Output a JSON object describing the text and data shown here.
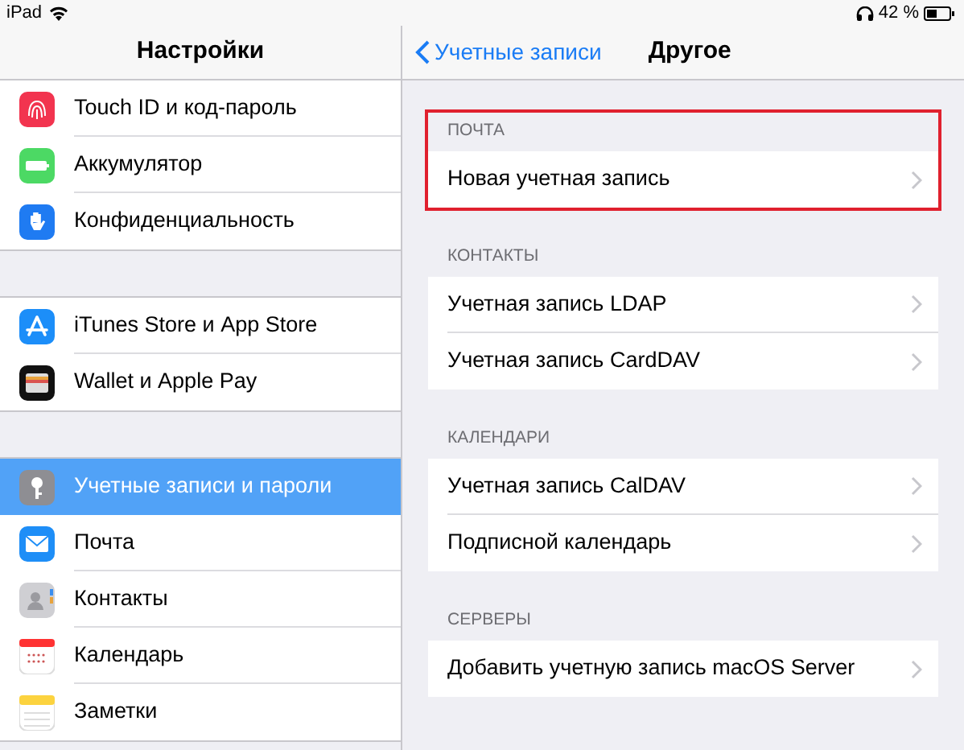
{
  "status_bar": {
    "device": "iPad",
    "battery_text": "42 %"
  },
  "sidebar": {
    "title": "Настройки",
    "groups": [
      {
        "items": [
          {
            "label": "Touch ID и код-пароль",
            "selected": false
          },
          {
            "label": "Аккумулятор",
            "selected": false
          },
          {
            "label": "Конфиденциальность",
            "selected": false
          }
        ]
      },
      {
        "items": [
          {
            "label": "iTunes Store и App Store",
            "selected": false
          },
          {
            "label": "Wallet и Apple Pay",
            "selected": false
          }
        ]
      },
      {
        "items": [
          {
            "label": "Учетные записи и пароли",
            "selected": true
          },
          {
            "label": "Почта",
            "selected": false
          },
          {
            "label": "Контакты",
            "selected": false
          },
          {
            "label": "Календарь",
            "selected": false
          },
          {
            "label": "Заметки",
            "selected": false
          }
        ]
      }
    ]
  },
  "detail": {
    "back_label": "Учетные записи",
    "title": "Другое",
    "sections": [
      {
        "header": "ПОЧТА",
        "highlighted": true,
        "rows": [
          "Новая учетная запись"
        ]
      },
      {
        "header": "КОНТАКТЫ",
        "highlighted": false,
        "rows": [
          "Учетная запись LDAP",
          "Учетная запись CardDAV"
        ]
      },
      {
        "header": "КАЛЕНДАРИ",
        "highlighted": false,
        "rows": [
          "Учетная запись CalDAV",
          "Подписной календарь"
        ]
      },
      {
        "header": "СЕРВЕРЫ",
        "highlighted": false,
        "rows": [
          "Добавить учетную запись macOS Server"
        ]
      }
    ]
  }
}
